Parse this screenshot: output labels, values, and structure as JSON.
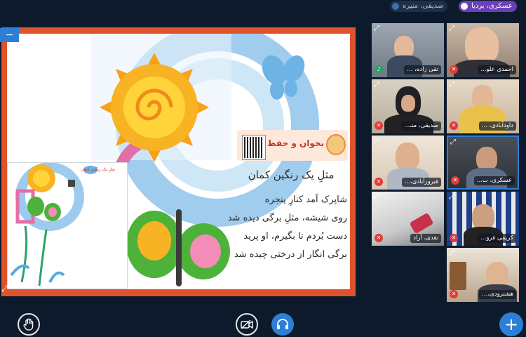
{
  "speakers": [
    {
      "name": "عسکری، بردیا",
      "active": true
    },
    {
      "name": "صدیقی، منیره",
      "active": false
    }
  ],
  "lesson": {
    "section_title": "بخوان و حفظ کن",
    "poem_heading": "مثلِ یک رنگین کمان",
    "poem_lines": [
      "شاپرک آمد کنارِ پنجره",
      "روی شیشه، مثلِ برگی دیده شد",
      "دست بُردم تا بگیرم، او پرید",
      "برگی انگار از درختی چیده شد"
    ]
  },
  "thumbnail": {
    "title": "مثلِ یک رنگین کمان"
  },
  "participants": [
    {
      "name": "تقی زاده، ...",
      "mic": "on"
    },
    {
      "name": "احمدی علو...",
      "mic": "off"
    },
    {
      "name": "صدیقی، منـ...",
      "mic": "off"
    },
    {
      "name": "داودآبادی، ...",
      "mic": "off"
    },
    {
      "name": "فیروزآبادی،...",
      "mic": "off"
    },
    {
      "name": "عسکری، ب...",
      "mic": "off"
    },
    {
      "name": "نقدی، آراد",
      "mic": "off"
    },
    {
      "name": "کریمی فرو...",
      "mic": "off"
    },
    {
      "name": "هشترودی،...",
      "mic": "off"
    }
  ],
  "controls": {
    "hand_icon": "raise-hand-icon",
    "camera_icon": "camera-off-icon",
    "audio_icon": "headphones-icon",
    "add_label": "+"
  },
  "colors": {
    "background": "#0c1a2c",
    "accent": "#2d7fd6",
    "frame": "#e0522b",
    "active_speaker": "#6a3fb8",
    "mic_off": "#e53935"
  }
}
